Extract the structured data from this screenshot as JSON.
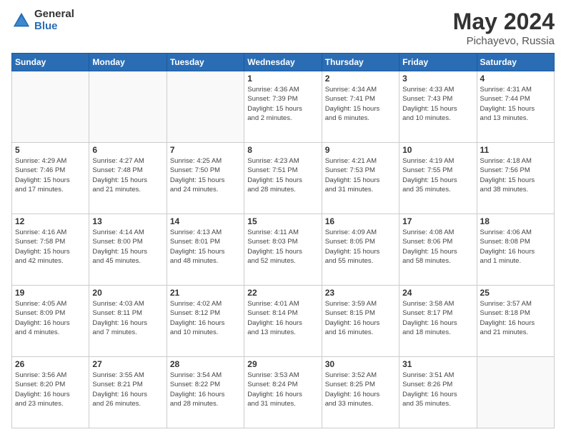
{
  "header": {
    "logo_general": "General",
    "logo_blue": "Blue",
    "title": "May 2024",
    "location": "Pichayevo, Russia"
  },
  "days_of_week": [
    "Sunday",
    "Monday",
    "Tuesday",
    "Wednesday",
    "Thursday",
    "Friday",
    "Saturday"
  ],
  "weeks": [
    [
      {
        "num": "",
        "info": ""
      },
      {
        "num": "",
        "info": ""
      },
      {
        "num": "",
        "info": ""
      },
      {
        "num": "1",
        "info": "Sunrise: 4:36 AM\nSunset: 7:39 PM\nDaylight: 15 hours\nand 2 minutes."
      },
      {
        "num": "2",
        "info": "Sunrise: 4:34 AM\nSunset: 7:41 PM\nDaylight: 15 hours\nand 6 minutes."
      },
      {
        "num": "3",
        "info": "Sunrise: 4:33 AM\nSunset: 7:43 PM\nDaylight: 15 hours\nand 10 minutes."
      },
      {
        "num": "4",
        "info": "Sunrise: 4:31 AM\nSunset: 7:44 PM\nDaylight: 15 hours\nand 13 minutes."
      }
    ],
    [
      {
        "num": "5",
        "info": "Sunrise: 4:29 AM\nSunset: 7:46 PM\nDaylight: 15 hours\nand 17 minutes."
      },
      {
        "num": "6",
        "info": "Sunrise: 4:27 AM\nSunset: 7:48 PM\nDaylight: 15 hours\nand 21 minutes."
      },
      {
        "num": "7",
        "info": "Sunrise: 4:25 AM\nSunset: 7:50 PM\nDaylight: 15 hours\nand 24 minutes."
      },
      {
        "num": "8",
        "info": "Sunrise: 4:23 AM\nSunset: 7:51 PM\nDaylight: 15 hours\nand 28 minutes."
      },
      {
        "num": "9",
        "info": "Sunrise: 4:21 AM\nSunset: 7:53 PM\nDaylight: 15 hours\nand 31 minutes."
      },
      {
        "num": "10",
        "info": "Sunrise: 4:19 AM\nSunset: 7:55 PM\nDaylight: 15 hours\nand 35 minutes."
      },
      {
        "num": "11",
        "info": "Sunrise: 4:18 AM\nSunset: 7:56 PM\nDaylight: 15 hours\nand 38 minutes."
      }
    ],
    [
      {
        "num": "12",
        "info": "Sunrise: 4:16 AM\nSunset: 7:58 PM\nDaylight: 15 hours\nand 42 minutes."
      },
      {
        "num": "13",
        "info": "Sunrise: 4:14 AM\nSunset: 8:00 PM\nDaylight: 15 hours\nand 45 minutes."
      },
      {
        "num": "14",
        "info": "Sunrise: 4:13 AM\nSunset: 8:01 PM\nDaylight: 15 hours\nand 48 minutes."
      },
      {
        "num": "15",
        "info": "Sunrise: 4:11 AM\nSunset: 8:03 PM\nDaylight: 15 hours\nand 52 minutes."
      },
      {
        "num": "16",
        "info": "Sunrise: 4:09 AM\nSunset: 8:05 PM\nDaylight: 15 hours\nand 55 minutes."
      },
      {
        "num": "17",
        "info": "Sunrise: 4:08 AM\nSunset: 8:06 PM\nDaylight: 15 hours\nand 58 minutes."
      },
      {
        "num": "18",
        "info": "Sunrise: 4:06 AM\nSunset: 8:08 PM\nDaylight: 16 hours\nand 1 minute."
      }
    ],
    [
      {
        "num": "19",
        "info": "Sunrise: 4:05 AM\nSunset: 8:09 PM\nDaylight: 16 hours\nand 4 minutes."
      },
      {
        "num": "20",
        "info": "Sunrise: 4:03 AM\nSunset: 8:11 PM\nDaylight: 16 hours\nand 7 minutes."
      },
      {
        "num": "21",
        "info": "Sunrise: 4:02 AM\nSunset: 8:12 PM\nDaylight: 16 hours\nand 10 minutes."
      },
      {
        "num": "22",
        "info": "Sunrise: 4:01 AM\nSunset: 8:14 PM\nDaylight: 16 hours\nand 13 minutes."
      },
      {
        "num": "23",
        "info": "Sunrise: 3:59 AM\nSunset: 8:15 PM\nDaylight: 16 hours\nand 16 minutes."
      },
      {
        "num": "24",
        "info": "Sunrise: 3:58 AM\nSunset: 8:17 PM\nDaylight: 16 hours\nand 18 minutes."
      },
      {
        "num": "25",
        "info": "Sunrise: 3:57 AM\nSunset: 8:18 PM\nDaylight: 16 hours\nand 21 minutes."
      }
    ],
    [
      {
        "num": "26",
        "info": "Sunrise: 3:56 AM\nSunset: 8:20 PM\nDaylight: 16 hours\nand 23 minutes."
      },
      {
        "num": "27",
        "info": "Sunrise: 3:55 AM\nSunset: 8:21 PM\nDaylight: 16 hours\nand 26 minutes."
      },
      {
        "num": "28",
        "info": "Sunrise: 3:54 AM\nSunset: 8:22 PM\nDaylight: 16 hours\nand 28 minutes."
      },
      {
        "num": "29",
        "info": "Sunrise: 3:53 AM\nSunset: 8:24 PM\nDaylight: 16 hours\nand 31 minutes."
      },
      {
        "num": "30",
        "info": "Sunrise: 3:52 AM\nSunset: 8:25 PM\nDaylight: 16 hours\nand 33 minutes."
      },
      {
        "num": "31",
        "info": "Sunrise: 3:51 AM\nSunset: 8:26 PM\nDaylight: 16 hours\nand 35 minutes."
      },
      {
        "num": "",
        "info": ""
      }
    ]
  ]
}
